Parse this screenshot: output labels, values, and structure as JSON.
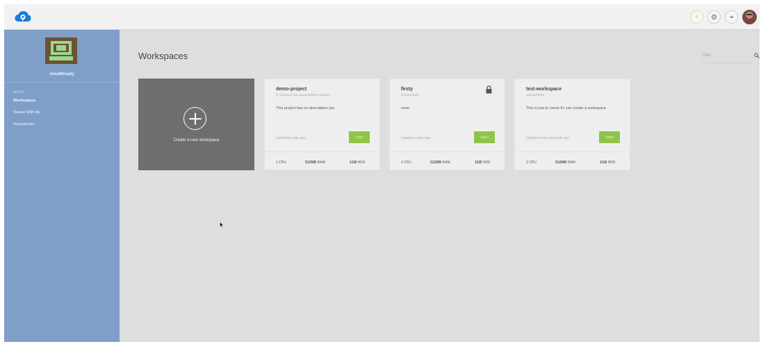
{
  "colors": {
    "sidebar": "#7f9fc9",
    "open_button": "#8fc34a",
    "create_card": "#6f6e6d"
  },
  "topbar": {
    "logo_icon": "cloud-logo-icon",
    "actions": [
      {
        "icon": "plus-icon"
      },
      {
        "icon": "gear-icon"
      },
      {
        "icon": "logout-icon"
      },
      {
        "icon": "avatar"
      }
    ]
  },
  "sidebar": {
    "username": "cloud9ready",
    "menu_label": "MENU",
    "items": [
      {
        "label": "Workspaces",
        "active": true
      },
      {
        "label": "Shared With Me",
        "active": false
      },
      {
        "label": "Repositories",
        "active": false
      }
    ]
  },
  "main": {
    "title": "Workspaces",
    "filter_placeholder": "Filter...",
    "create_label": "Create a new workspace"
  },
  "workspaces": [
    {
      "name": "demo-project",
      "origin": "Cloned from ajaxorg/demo-project",
      "description": "This project has no description yet.",
      "updated": "Updated a day ago.",
      "open_label": "Open",
      "cpu": "1 CPU",
      "ram_value": "512MB",
      "ram_unit": "RAM",
      "hdd_value": "1GB",
      "hdd_unit": "HDD"
    },
    {
      "name": "firsty",
      "origin": "Cloned from",
      "description": "nooo",
      "updated": "Updated a day ago.",
      "open_label": "Open",
      "private": true,
      "cpu": "1 CPU",
      "ram_value": "512MB",
      "ram_unit": "RAM",
      "hdd_value": "1GB",
      "hdd_unit": "HDD"
    },
    {
      "name": "test-workspace",
      "origin": "Cloned from",
      "description": "This is just to check if I can create a workspace",
      "updated": "Updated a few seconds ago.",
      "open_label": "Open",
      "cpu": "1 CPU",
      "ram_value": "512MB",
      "ram_unit": "RAM",
      "hdd_value": "1GB",
      "hdd_unit": "HDD"
    }
  ]
}
